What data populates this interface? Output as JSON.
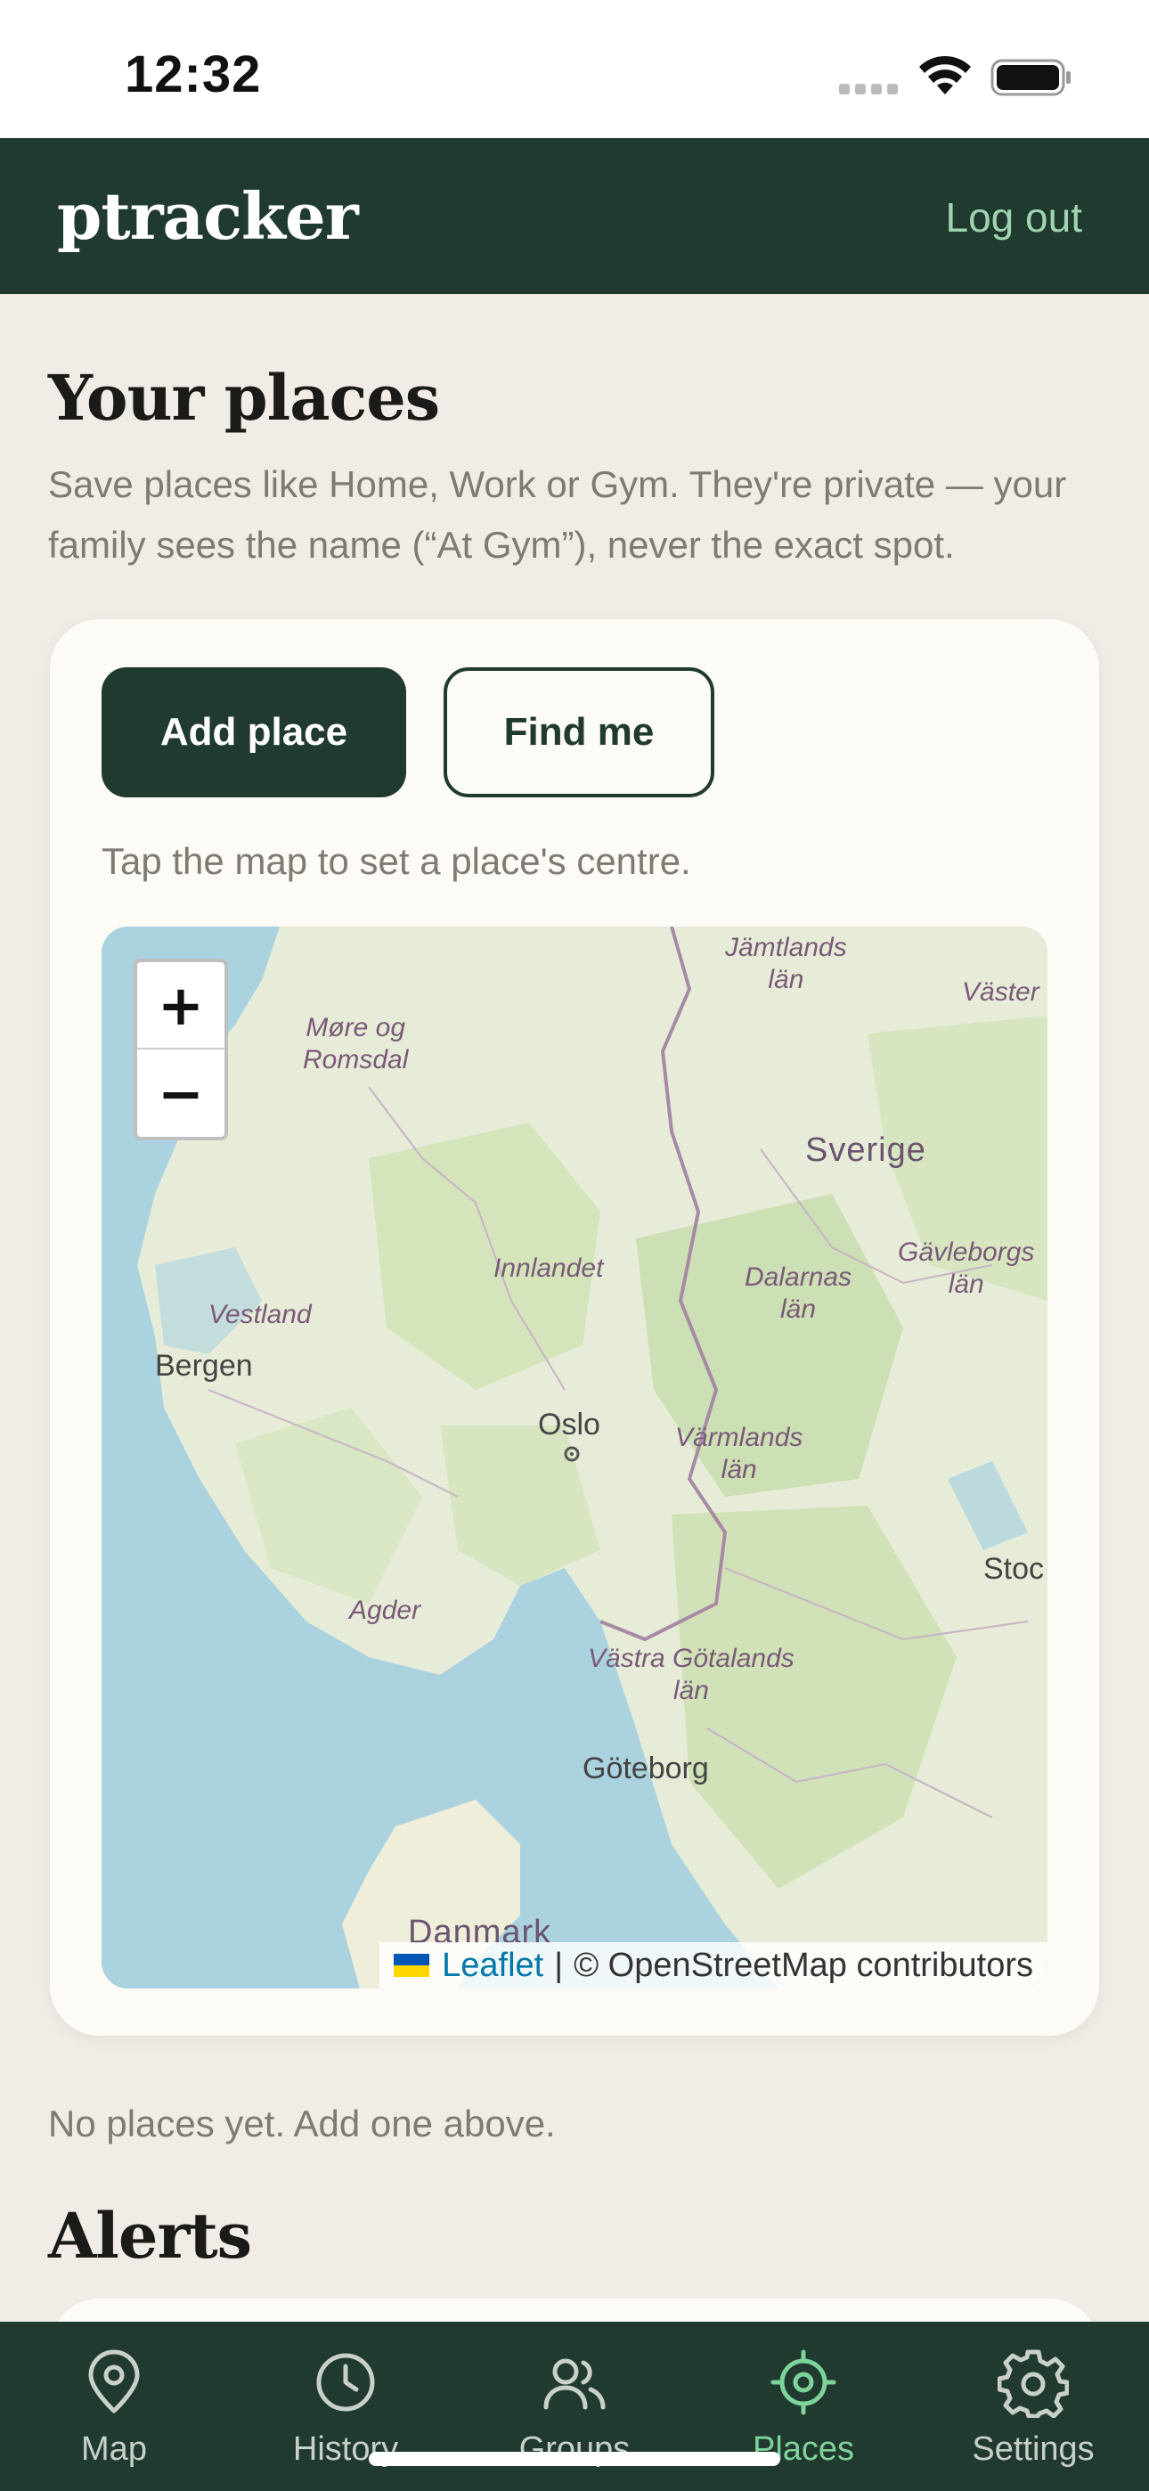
{
  "status": {
    "time": "12:32"
  },
  "header": {
    "brand": "ptracker",
    "logout_label": "Log out"
  },
  "places": {
    "title": "Your places",
    "description": "Save places like Home, Work or Gym. They're private — your family sees the name (“At Gym”), never the exact spot.",
    "add_label": "Add place",
    "find_label": "Find me",
    "hint": "Tap the map to set a place's centre.",
    "empty_text": "No places yet. Add one above."
  },
  "map": {
    "zoom_in": "+",
    "zoom_out": "−",
    "attribution_link": "Leaflet",
    "attribution_sep": "|",
    "attribution_text": "© OpenStreetMap contributors",
    "labels": {
      "jamtlands": "Jämtlands\nlän",
      "vaster": "Väster",
      "more": "Møre og\nRomsdal",
      "sverige": "Sverige",
      "gavleborgs": "Gävleborgs\nlän",
      "innlandet": "Innlandet",
      "dalarnas": "Dalarnas\nlän",
      "vestland": "Vestland",
      "bergen": "Bergen",
      "oslo": "Oslo",
      "varmlands": "Värmlands\nlän",
      "stoc": "Stoc",
      "agder": "Agder",
      "vastra": "Västra Götalands\nlän",
      "goteborg": "Göteborg",
      "danmark": "Danmark"
    }
  },
  "alerts": {
    "title": "Alerts"
  },
  "nav": {
    "items": [
      {
        "label": "Map",
        "icon": "map-pin-icon"
      },
      {
        "label": "History",
        "icon": "clock-icon"
      },
      {
        "label": "Groups",
        "icon": "users-icon"
      },
      {
        "label": "Places",
        "icon": "target-icon"
      },
      {
        "label": "Settings",
        "icon": "gear-icon"
      }
    ],
    "active": "Places"
  },
  "colors": {
    "primary": "#213a2f",
    "accent": "#7ed39a",
    "background": "#f1ede6"
  }
}
